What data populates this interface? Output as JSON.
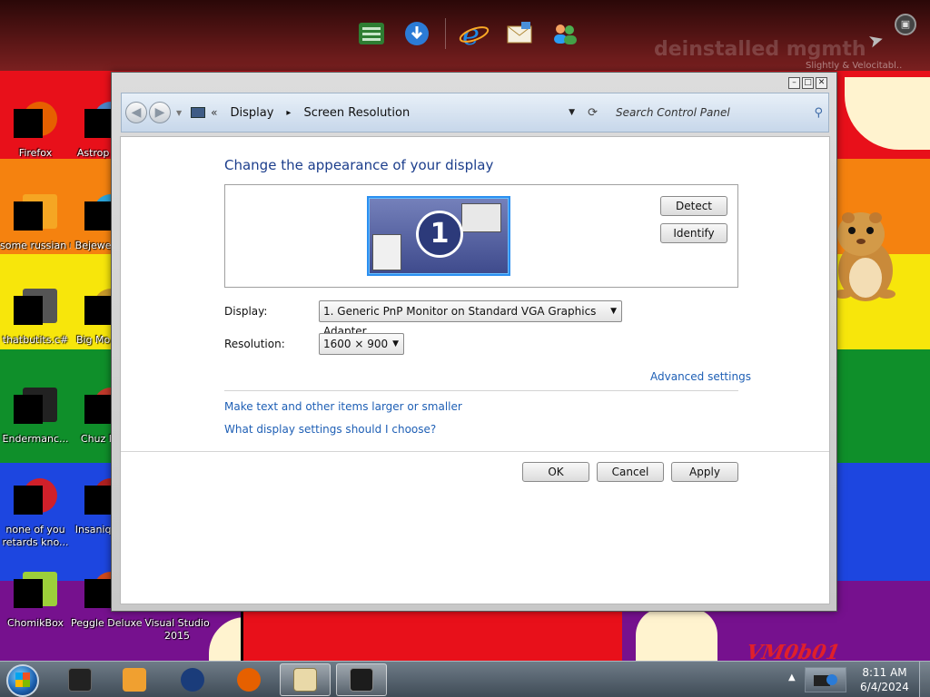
{
  "wallpaper": {
    "watermark_text": "deinstalled mgmth",
    "watermark_sub": "Slightly & Velocitabl..",
    "vm_label": "VM0b01"
  },
  "dock": {
    "icons": [
      "spreadsheet-icon",
      "internet-download-icon",
      "internet-explorer-icon",
      "mail-icon",
      "people-icon"
    ]
  },
  "desktop_icons": [
    {
      "label": "Firefox",
      "icon": "firefox-icon",
      "color": "#e66000"
    },
    {
      "label": "Astrop Delu",
      "icon": "game-icon",
      "color": "#4a86c8"
    },
    {
      "label": "some russian ran a rat",
      "icon": "e-document-icon",
      "color": "#f5a623"
    },
    {
      "label": "Bejewe Delu",
      "icon": "gem-icon",
      "color": "#2aa3d8"
    },
    {
      "label": "thatbutits.c#",
      "icon": "file-icon",
      "color": "#555555"
    },
    {
      "label": "Big Mo Delu",
      "icon": "game-icon",
      "color": "#c89a2a"
    },
    {
      "label": "Endermanc...",
      "icon": "window-app-icon",
      "color": "#222222"
    },
    {
      "label": "Chuz Delu",
      "icon": "game-icon",
      "color": "#c0392b"
    },
    {
      "label": "none of you retards kno...",
      "icon": "red-circle-icon",
      "color": "#d0202a"
    },
    {
      "label": "Insaniq Delu",
      "icon": "game-icon",
      "color": "#b02020"
    },
    {
      "label": "ChomikBox",
      "icon": "hamster-box-icon",
      "color": "#9ccf3a"
    },
    {
      "label": "Peggle Deluxe",
      "icon": "game-icon",
      "color": "#d04a1a"
    },
    {
      "label": "Visual Studio 2015",
      "icon": "visual-studio-icon",
      "color": "#68217a"
    }
  ],
  "window": {
    "breadcrumb": [
      "Display",
      "Screen Resolution"
    ],
    "search_placeholder": "Search Control Panel",
    "heading": "Change the appearance of your display",
    "monitor_number": "1",
    "detect_label": "Detect",
    "identify_label": "Identify",
    "display_label": "Display:",
    "display_value": "1. Generic PnP Monitor on Standard VGA Graphics Adapter",
    "resolution_label": "Resolution:",
    "resolution_value": "1600 × 900",
    "advanced_link": "Advanced settings",
    "link_text_size": "Make text and other items larger or smaller",
    "link_choose": "What display settings should I choose?",
    "ok_label": "OK",
    "cancel_label": "Cancel",
    "apply_label": "Apply"
  },
  "taskbar": {
    "items": [
      "explorer-icon",
      "media-player-icon",
      "browser-orb-icon",
      "firefox-icon",
      "control-panel-icon",
      "display-icon"
    ],
    "time": "8:11 AM",
    "date": "6/4/2024"
  }
}
